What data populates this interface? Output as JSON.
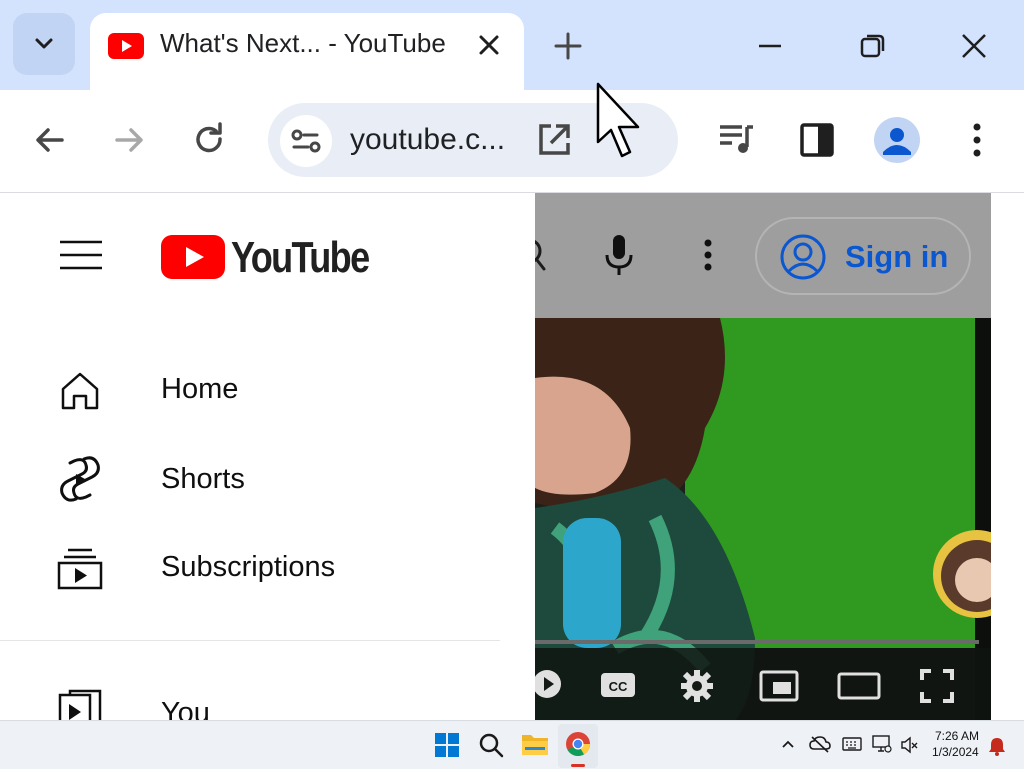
{
  "browser": {
    "tab": {
      "title": "What's Next... - YouTube",
      "favicon": "youtube-icon"
    },
    "address": {
      "url": "youtube.c..."
    },
    "icons": [
      "back-arrow-icon",
      "forward-arrow-icon",
      "reload-icon",
      "site-info-icon",
      "open-in-new-icon",
      "media-controls-icon",
      "side-panel-icon",
      "profile-icon",
      "more-vert-icon",
      "minimize-icon",
      "restore-icon",
      "close-icon",
      "new-tab-icon",
      "tab-search-icon"
    ]
  },
  "youtube": {
    "logo_text": "YouTube",
    "header": {
      "sign_in_label": "Sign in"
    },
    "sidebar": {
      "items": [
        {
          "label": "Home",
          "icon": "home-icon"
        },
        {
          "label": "Shorts",
          "icon": "shorts-icon"
        },
        {
          "label": "Subscriptions",
          "icon": "subscriptions-icon"
        },
        {
          "label": "You",
          "icon": "you-icon"
        }
      ]
    },
    "player_controls": [
      "play-icon",
      "captions-icon",
      "settings-icon",
      "miniplayer-icon",
      "theater-icon",
      "fullscreen-icon"
    ]
  },
  "taskbar": {
    "clock": {
      "time": "7:26 AM",
      "date": "1/3/2024"
    },
    "icons": [
      "windows-start-icon",
      "search-icon",
      "file-explorer-icon",
      "chrome-icon",
      "chevron-up-icon",
      "onedrive-icon",
      "keyboard-icon",
      "network-icon",
      "volume-muted-icon",
      "notification-bell-icon"
    ]
  },
  "colors": {
    "titlebar": "#d3e3fd",
    "youtube_red": "#ff0000",
    "signin_blue": "#0b57d0",
    "notification_red": "#c42b1c"
  }
}
